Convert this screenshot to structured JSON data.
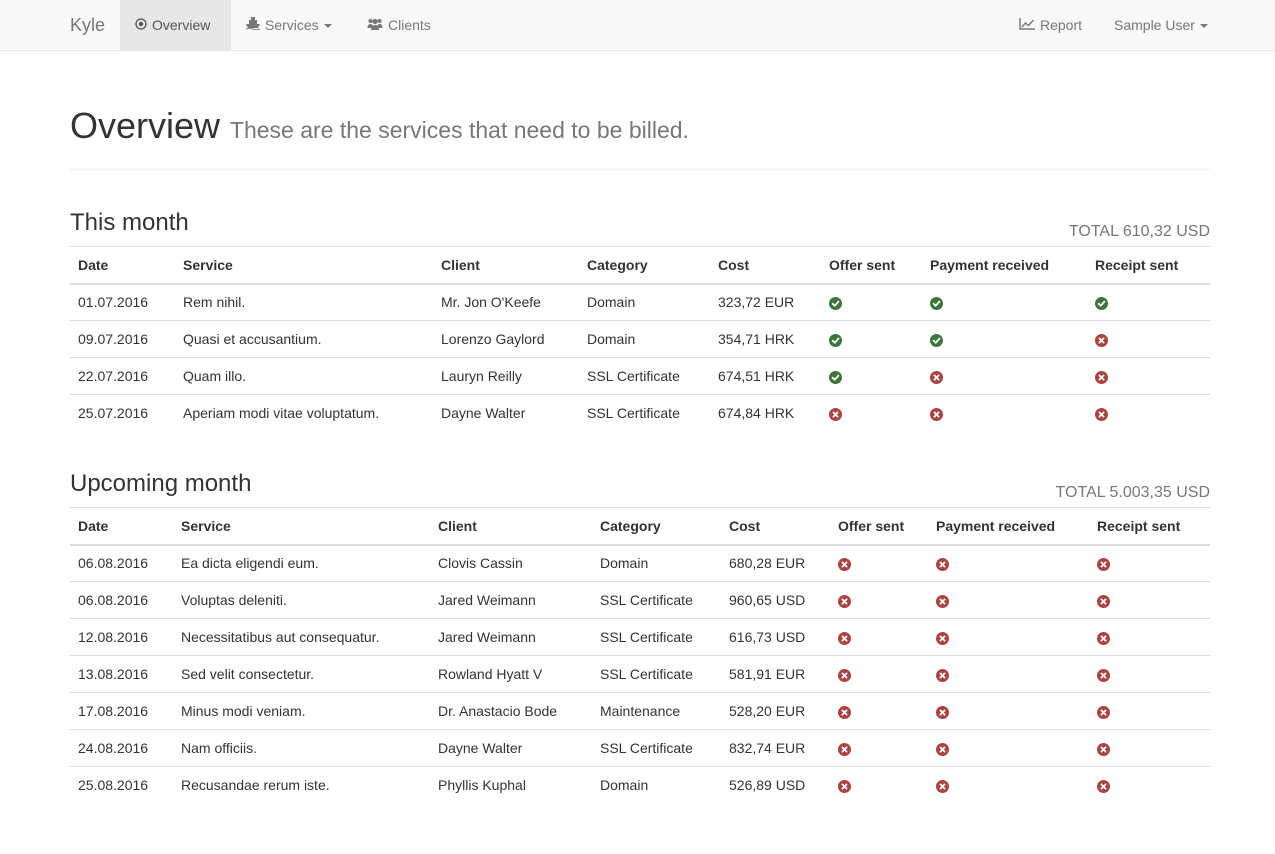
{
  "nav": {
    "brand": "Kyle",
    "items": [
      {
        "label": "Overview",
        "icon": "target-icon",
        "active": true
      },
      {
        "label": "Services",
        "icon": "ship-icon",
        "dropdown": true
      },
      {
        "label": "Clients",
        "icon": "users-icon"
      }
    ],
    "right": [
      {
        "label": "Report",
        "icon": "line-chart-icon"
      },
      {
        "label": "Sample User",
        "dropdown": true
      }
    ]
  },
  "header": {
    "title": "Overview",
    "subtitle": "These are the services that need to be billed."
  },
  "colors": {
    "ok": "#3c763d",
    "no": "#a94442"
  },
  "columns": [
    "Date",
    "Service",
    "Client",
    "Category",
    "Cost",
    "Offer sent",
    "Payment received",
    "Receipt sent"
  ],
  "this_month": {
    "title": "This month",
    "total": "TOTAL 610,32 USD",
    "rows": [
      {
        "date": "01.07.2016",
        "service": "Rem nihil.",
        "client": "Mr. Jon O'Keefe",
        "category": "Domain",
        "cost": "323,72 EUR",
        "offer": true,
        "payment": true,
        "receipt": true
      },
      {
        "date": "09.07.2016",
        "service": "Quasi et accusantium.",
        "client": "Lorenzo Gaylord",
        "category": "Domain",
        "cost": "354,71 HRK",
        "offer": true,
        "payment": true,
        "receipt": false
      },
      {
        "date": "22.07.2016",
        "service": "Quam illo.",
        "client": "Lauryn Reilly",
        "category": "SSL Certificate",
        "cost": "674,51 HRK",
        "offer": true,
        "payment": false,
        "receipt": false
      },
      {
        "date": "25.07.2016",
        "service": "Aperiam modi vitae voluptatum.",
        "client": "Dayne Walter",
        "category": "SSL Certificate",
        "cost": "674,84 HRK",
        "offer": false,
        "payment": false,
        "receipt": false
      }
    ]
  },
  "upcoming_month": {
    "title": "Upcoming month",
    "total": "TOTAL 5.003,35 USD",
    "rows": [
      {
        "date": "06.08.2016",
        "service": "Ea dicta eligendi eum.",
        "client": "Clovis Cassin",
        "category": "Domain",
        "cost": "680,28 EUR",
        "offer": false,
        "payment": false,
        "receipt": false
      },
      {
        "date": "06.08.2016",
        "service": "Voluptas deleniti.",
        "client": "Jared Weimann",
        "category": "SSL Certificate",
        "cost": "960,65 USD",
        "offer": false,
        "payment": false,
        "receipt": false
      },
      {
        "date": "12.08.2016",
        "service": "Necessitatibus aut consequatur.",
        "client": "Jared Weimann",
        "category": "SSL Certificate",
        "cost": "616,73 USD",
        "offer": false,
        "payment": false,
        "receipt": false
      },
      {
        "date": "13.08.2016",
        "service": "Sed velit consectetur.",
        "client": "Rowland Hyatt V",
        "category": "SSL Certificate",
        "cost": "581,91 EUR",
        "offer": false,
        "payment": false,
        "receipt": false
      },
      {
        "date": "17.08.2016",
        "service": "Minus modi veniam.",
        "client": "Dr. Anastacio Bode",
        "category": "Maintenance",
        "cost": "528,20 EUR",
        "offer": false,
        "payment": false,
        "receipt": false
      },
      {
        "date": "24.08.2016",
        "service": "Nam officiis.",
        "client": "Dayne Walter",
        "category": "SSL Certificate",
        "cost": "832,74 EUR",
        "offer": false,
        "payment": false,
        "receipt": false
      },
      {
        "date": "25.08.2016",
        "service": "Recusandae rerum iste.",
        "client": "Phyllis Kuphal",
        "category": "Domain",
        "cost": "526,89 USD",
        "offer": false,
        "payment": false,
        "receipt": false
      }
    ]
  }
}
